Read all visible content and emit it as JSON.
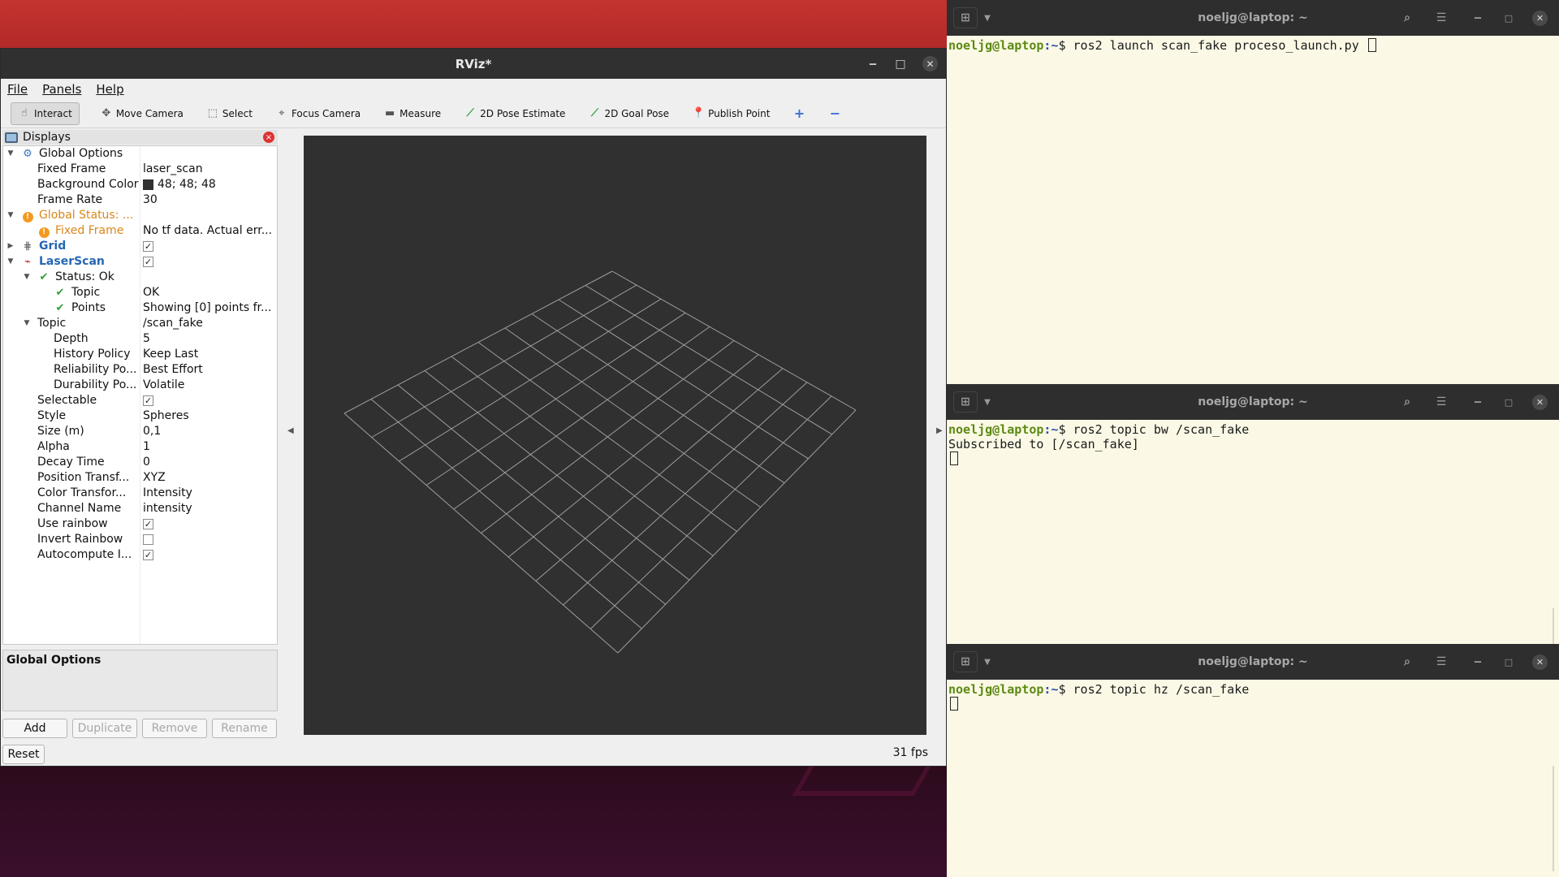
{
  "rviz": {
    "title": "RViz*",
    "menu": [
      "File",
      "Panels",
      "Help"
    ],
    "tools": [
      {
        "label": "Interact",
        "icon": "hand-icon"
      },
      {
        "label": "Move Camera",
        "icon": "move-camera-icon"
      },
      {
        "label": "Select",
        "icon": "select-icon"
      },
      {
        "label": "Focus Camera",
        "icon": "focus-camera-icon"
      },
      {
        "label": "Measure",
        "icon": "measure-icon"
      },
      {
        "label": "2D Pose Estimate",
        "icon": "pose-estimate-icon"
      },
      {
        "label": "2D Goal Pose",
        "icon": "goal-pose-icon"
      },
      {
        "label": "Publish Point",
        "icon": "publish-point-icon"
      }
    ],
    "displays": {
      "title": "Displays",
      "rows": [
        {
          "label": "Global Options",
          "value": ""
        },
        {
          "label": "Fixed Frame",
          "value": "laser_scan"
        },
        {
          "label": "Background Color",
          "value": "48; 48; 48"
        },
        {
          "label": "Frame Rate",
          "value": "30"
        },
        {
          "label": "Global Status: ...",
          "value": ""
        },
        {
          "label": "Fixed Frame",
          "value": "No tf data.  Actual err..."
        },
        {
          "label": "Grid",
          "value": ""
        },
        {
          "label": "LaserScan",
          "value": ""
        },
        {
          "label": "Status: Ok",
          "value": ""
        },
        {
          "label": "Topic",
          "value": "OK"
        },
        {
          "label": "Points",
          "value": "Showing [0] points fr..."
        },
        {
          "label": "Topic",
          "value": "/scan_fake"
        },
        {
          "label": "Depth",
          "value": "5"
        },
        {
          "label": "History Policy",
          "value": "Keep Last"
        },
        {
          "label": "Reliability Po...",
          "value": "Best Effort"
        },
        {
          "label": "Durability Po...",
          "value": "Volatile"
        },
        {
          "label": "Selectable",
          "value": ""
        },
        {
          "label": "Style",
          "value": "Spheres"
        },
        {
          "label": "Size (m)",
          "value": "0,1"
        },
        {
          "label": "Alpha",
          "value": "1"
        },
        {
          "label": "Decay Time",
          "value": "0"
        },
        {
          "label": "Position Transf...",
          "value": "XYZ"
        },
        {
          "label": "Color Transfor...",
          "value": "Intensity"
        },
        {
          "label": "Channel Name",
          "value": "intensity"
        },
        {
          "label": "Use rainbow",
          "value": ""
        },
        {
          "label": "Invert Rainbow",
          "value": ""
        },
        {
          "label": "Autocompute I...",
          "value": ""
        }
      ],
      "checkboxes": {
        "grid": true,
        "laserscan": true,
        "selectable": true,
        "use_rainbow": true,
        "invert_rainbow": false,
        "autocompute": true
      }
    },
    "description_title": "Global Options",
    "buttons": {
      "add": "Add",
      "duplicate": "Duplicate",
      "remove": "Remove",
      "rename": "Rename",
      "reset": "Reset"
    },
    "fps": "31 fps",
    "colors": {
      "viewport_bg": "#303030",
      "grid_line": "#a0a0a0",
      "background_swatch": "#303030"
    }
  },
  "terminals": [
    {
      "title": "noeljg@laptop: ~",
      "user": "noeljg@laptop",
      "path": ":~",
      "lines": [
        "$ ros2 launch scan_fake proceso_launch.py"
      ]
    },
    {
      "title": "noeljg@laptop: ~",
      "user": "noeljg@laptop",
      "path": ":~",
      "lines": [
        "$ ros2 topic bw /scan_fake",
        "Subscribed to [/scan_fake]"
      ]
    },
    {
      "title": "noeljg@laptop: ~",
      "user": "noeljg@laptop",
      "path": ":~",
      "lines": [
        "$ ros2 topic hz /scan_fake"
      ]
    }
  ]
}
